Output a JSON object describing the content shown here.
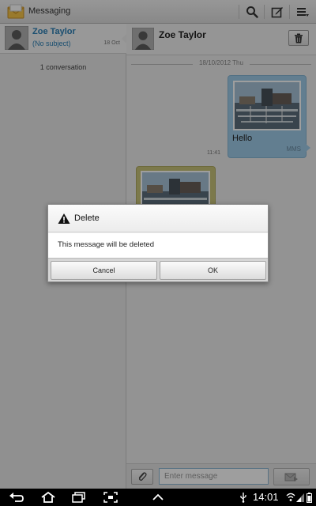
{
  "actionbar": {
    "title": "Messaging",
    "icons": [
      "messaging-app-icon",
      "search-icon",
      "compose-icon",
      "menu-icon"
    ]
  },
  "conversation_list": {
    "items": [
      {
        "name": "Zoe Taylor",
        "subject": "(No subject)",
        "date": "18 Oct"
      }
    ],
    "count_label": "1 conversation"
  },
  "thread": {
    "contact_name": "Zoe Taylor",
    "date_divider": "18/10/2012 Thu",
    "outgoing": {
      "text": "Hello",
      "type_label": "MMS",
      "time": "11:41"
    }
  },
  "composer": {
    "placeholder": "Enter message"
  },
  "dialog": {
    "title": "Delete",
    "message": "This message will be deleted",
    "cancel_label": "Cancel",
    "ok_label": "OK"
  },
  "system_bar": {
    "time": "14:01"
  },
  "colors": {
    "accent_blue": "#2a7fb5",
    "outgoing_bubble": "#9ecbe8",
    "incoming_bubble": "#c8c37a"
  }
}
